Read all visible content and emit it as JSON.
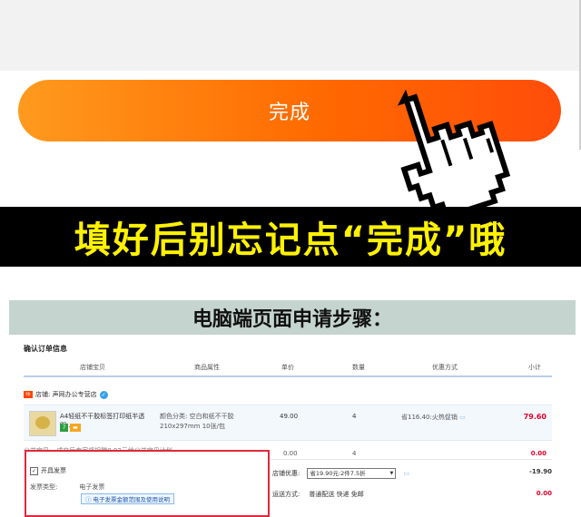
{
  "top": {
    "done_button_label": "完成"
  },
  "banner": {
    "text": "填好后别忘记点“完成”哦"
  },
  "section": {
    "title": "电脑端页面申请步骤："
  },
  "order": {
    "title": "确认订单信息",
    "columns": [
      "店铺宝贝",
      "商品属性",
      "单价",
      "数量",
      "优惠方式",
      "小计"
    ],
    "store": "店铺: 声网办公专营店",
    "item": {
      "name": "A4轻纸不干胶标签打印纸半透明...",
      "attr": "颜色分类: 空白和纸不干胶 210x297mm 10张/包",
      "price": "49.00",
      "qty": "4",
      "promo": "省116.40:火热促销",
      "subtotal": "79.60"
    },
    "gift": {
      "label": "公益宝贝",
      "text": "成交后卖家将捐赠0.02元给公益宝贝计划",
      "price": "0.00",
      "qty": "4",
      "subtotal": "0.00"
    },
    "invoice": {
      "checkbox_label": "开具发票",
      "type_label": "发票类型:",
      "type_value": "电子发票",
      "e_invoice_link": "电子发票金额范围及使用说明"
    },
    "discount": {
      "label": "店铺优惠:",
      "selected": "省19.90元:2件7.5折",
      "amount": "-19.90"
    },
    "shipping": {
      "label": "运送方式:",
      "value": "普通配送 快递 免邮",
      "amount": "0.00"
    }
  }
}
